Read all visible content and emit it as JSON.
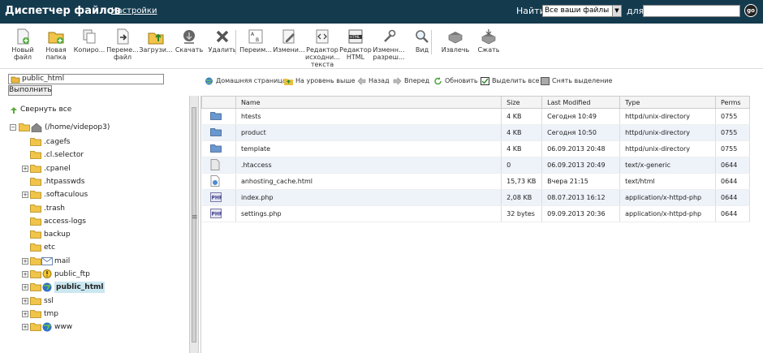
{
  "header": {
    "title": "Диспетчер файлов",
    "settings": "Настройки",
    "find_label": "Найти",
    "find_scope": "Все ваши файлы",
    "for_label": "для",
    "search_value": "",
    "go_label": "go"
  },
  "toolbar": [
    {
      "label": "Новый файл",
      "icon": "new-file-icon"
    },
    {
      "label": "Новая папка",
      "icon": "new-folder-icon"
    },
    {
      "label": "Копиро...",
      "icon": "copy-icon"
    },
    {
      "label": "Переме... файл",
      "icon": "move-file-icon"
    },
    {
      "label": "Загрузи...",
      "icon": "upload-icon"
    },
    {
      "label": "Скачать",
      "icon": "download-icon"
    },
    {
      "label": "Удалить",
      "icon": "delete-icon"
    },
    {
      "label": "Переим...",
      "icon": "rename-icon"
    },
    {
      "label": "Измени...",
      "icon": "edit-icon"
    },
    {
      "label": "Редактор исходни... текста",
      "icon": "code-editor-icon"
    },
    {
      "label": "Редактор HTML",
      "icon": "html-editor-icon"
    },
    {
      "label": "Изменн... разреш...",
      "icon": "permissions-icon"
    },
    {
      "label": "Вид",
      "icon": "view-icon"
    },
    {
      "label": "Извлечь",
      "icon": "extract-icon"
    },
    {
      "label": "Сжать",
      "icon": "compress-icon"
    }
  ],
  "path": {
    "value": "public_html",
    "go_label": "Выполнить"
  },
  "nav": {
    "home": "Домашняя страница",
    "up": "На уровень выше",
    "back": "Назад",
    "forward": "Вперед",
    "refresh": "Обновить",
    "select_all": "Выделить все",
    "deselect": "Снять выделение"
  },
  "tree": {
    "collapse_all": "Свернуть все",
    "root": "(/home/videpop3)",
    "items": [
      {
        "label": ".cagefs",
        "expandable": false,
        "icon": "folder-icon"
      },
      {
        "label": ".cl.selector",
        "expandable": false,
        "icon": "folder-icon"
      },
      {
        "label": ".cpanel",
        "expandable": true,
        "icon": "folder-icon"
      },
      {
        "label": ".htpasswds",
        "expandable": false,
        "icon": "folder-icon"
      },
      {
        "label": ".softaculous",
        "expandable": true,
        "icon": "folder-icon"
      },
      {
        "label": ".trash",
        "expandable": false,
        "icon": "folder-icon"
      },
      {
        "label": "access-logs",
        "expandable": false,
        "icon": "folder-icon"
      },
      {
        "label": "backup",
        "expandable": false,
        "icon": "folder-icon"
      },
      {
        "label": "etc",
        "expandable": false,
        "icon": "folder-icon"
      },
      {
        "label": "mail",
        "expandable": true,
        "icon": "mail-icon"
      },
      {
        "label": "public_ftp",
        "expandable": true,
        "icon": "ftp-icon"
      },
      {
        "label": "public_html",
        "expandable": true,
        "icon": "globe-icon",
        "selected": true
      },
      {
        "label": "ssl",
        "expandable": true,
        "icon": "folder-icon"
      },
      {
        "label": "tmp",
        "expandable": true,
        "icon": "folder-icon"
      },
      {
        "label": "www",
        "expandable": true,
        "icon": "globe-icon"
      }
    ]
  },
  "table": {
    "columns": [
      "Name",
      "Size",
      "Last Modified",
      "Type",
      "Perms"
    ],
    "rows": [
      {
        "icon": "folder-icon",
        "name": "htests",
        "size": "4 KB",
        "modified": "Сегодня 10:49",
        "type": "httpd/unix-directory",
        "perms": "0755"
      },
      {
        "icon": "folder-icon",
        "name": "product",
        "size": "4 KB",
        "modified": "Сегодня 10:50",
        "type": "httpd/unix-directory",
        "perms": "0755"
      },
      {
        "icon": "folder-icon",
        "name": "template",
        "size": "4 KB",
        "modified": "06.09.2013 20:48",
        "type": "httpd/unix-directory",
        "perms": "0755"
      },
      {
        "icon": "text-file-icon",
        "name": ".htaccess",
        "size": "0",
        "modified": "06.09.2013 20:49",
        "type": "text/x-generic",
        "perms": "0644"
      },
      {
        "icon": "html-file-icon",
        "name": "anhosting_cache.html",
        "size": "15,73 KB",
        "modified": "Вчера 21:15",
        "type": "text/html",
        "perms": "0644"
      },
      {
        "icon": "php-file-icon",
        "name": "index.php",
        "size": "2,08 KB",
        "modified": "08.07.2013 16:12",
        "type": "application/x-httpd-php",
        "perms": "0644"
      },
      {
        "icon": "php-file-icon",
        "name": "settings.php",
        "size": "32 bytes",
        "modified": "09.09.2013 20:36",
        "type": "application/x-httpd-php",
        "perms": "0644"
      }
    ]
  }
}
